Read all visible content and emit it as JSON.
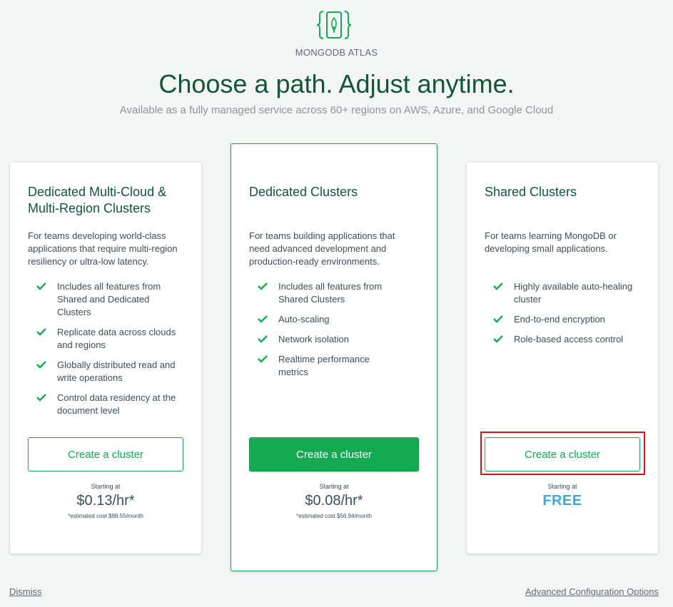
{
  "brand": "MONGODB ATLAS",
  "headline": "Choose a path. Adjust anytime.",
  "subhead": "Available as a fully managed service across 60+ regions on AWS, Azure, and Google Cloud",
  "colors": {
    "accent": "#13aa52",
    "title": "#13553a",
    "free": "#3fa8d6",
    "highlight": "#e0101a"
  },
  "cards": [
    {
      "title": "Dedicated Multi-Cloud & Multi-Region Clusters",
      "description": "For teams developing world-class applications that require multi-region resiliency or ultra-low latency.",
      "features": [
        "Includes all features from Shared and Dedicated Clusters",
        "Replicate data across clouds and regions",
        "Globally distributed read and write operations",
        "Control data residency at the document level"
      ],
      "button": "Create a cluster",
      "starting": "Starting at",
      "price": "$0.13/hr*",
      "estimate": "*estimated cost $98.55/month"
    },
    {
      "title": "Dedicated Clusters",
      "description": "For teams building applications that need advanced development and production-ready environments.",
      "features": [
        "Includes all features from Shared Clusters",
        "Auto-scaling",
        "Network isolation",
        "Realtime performance metrics"
      ],
      "button": "Create a cluster",
      "starting": "Starting at",
      "price": "$0.08/hr*",
      "estimate": "*estimated cost $56.94/month"
    },
    {
      "title": "Shared Clusters",
      "description": "For teams learning MongoDB or developing small applications.",
      "features": [
        "Highly available auto-healing cluster",
        "End-to-end encryption",
        "Role-based access control"
      ],
      "button": "Create a cluster",
      "starting": "Starting at",
      "price": "FREE"
    }
  ],
  "footer": {
    "dismiss": "Dismiss",
    "advanced": "Advanced Configuration Options"
  }
}
